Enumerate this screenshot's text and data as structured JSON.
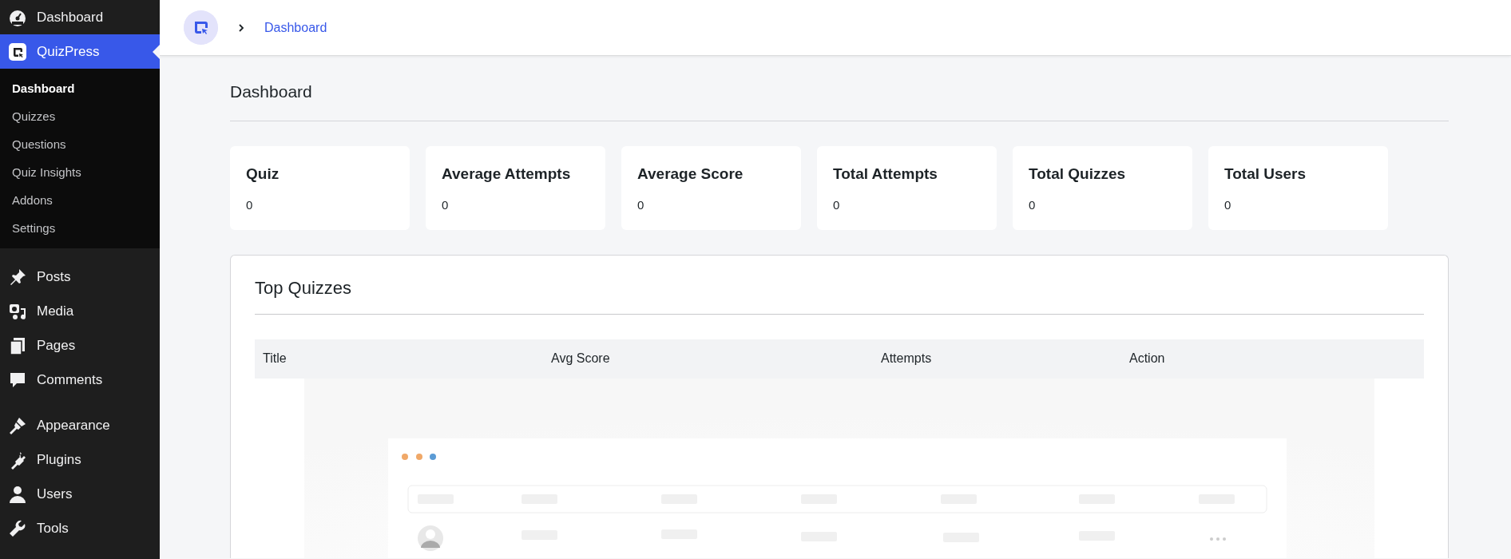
{
  "sidebar": {
    "items": [
      {
        "label": "Dashboard",
        "kind": "gauge",
        "selected": false
      },
      {
        "label": "QuizPress",
        "kind": "quizpress",
        "selected": true,
        "submenu": [
          {
            "label": "Dashboard",
            "selected": true
          },
          {
            "label": "Quizzes",
            "selected": false
          },
          {
            "label": "Questions",
            "selected": false
          },
          {
            "label": "Quiz Insights",
            "selected": false
          },
          {
            "label": "Addons",
            "selected": false
          },
          {
            "label": "Settings",
            "selected": false
          }
        ]
      },
      {
        "label": "Posts",
        "kind": "pin",
        "selected": false
      },
      {
        "label": "Media",
        "kind": "media",
        "selected": false
      },
      {
        "label": "Pages",
        "kind": "pages",
        "selected": false
      },
      {
        "label": "Comments",
        "kind": "comment",
        "selected": false
      },
      {
        "label": "Appearance",
        "kind": "brush",
        "selected": false
      },
      {
        "label": "Plugins",
        "kind": "plug",
        "selected": false
      },
      {
        "label": "Users",
        "kind": "user",
        "selected": false
      },
      {
        "label": "Tools",
        "kind": "wrench",
        "selected": false
      }
    ]
  },
  "breadcrumb": {
    "items": [
      "Dashboard"
    ]
  },
  "page_title": "Dashboard",
  "stats": [
    {
      "title": "Quiz",
      "value": "0"
    },
    {
      "title": "Average Attempts",
      "value": "0"
    },
    {
      "title": "Average Score",
      "value": "0"
    },
    {
      "title": "Total Attempts",
      "value": "0"
    },
    {
      "title": "Total Quizzes",
      "value": "0"
    },
    {
      "title": "Total Users",
      "value": "0"
    }
  ],
  "top_quizzes": {
    "title": "Top Quizzes",
    "columns": [
      "Title",
      "Avg Score",
      "Attempts",
      "Action"
    ]
  }
}
